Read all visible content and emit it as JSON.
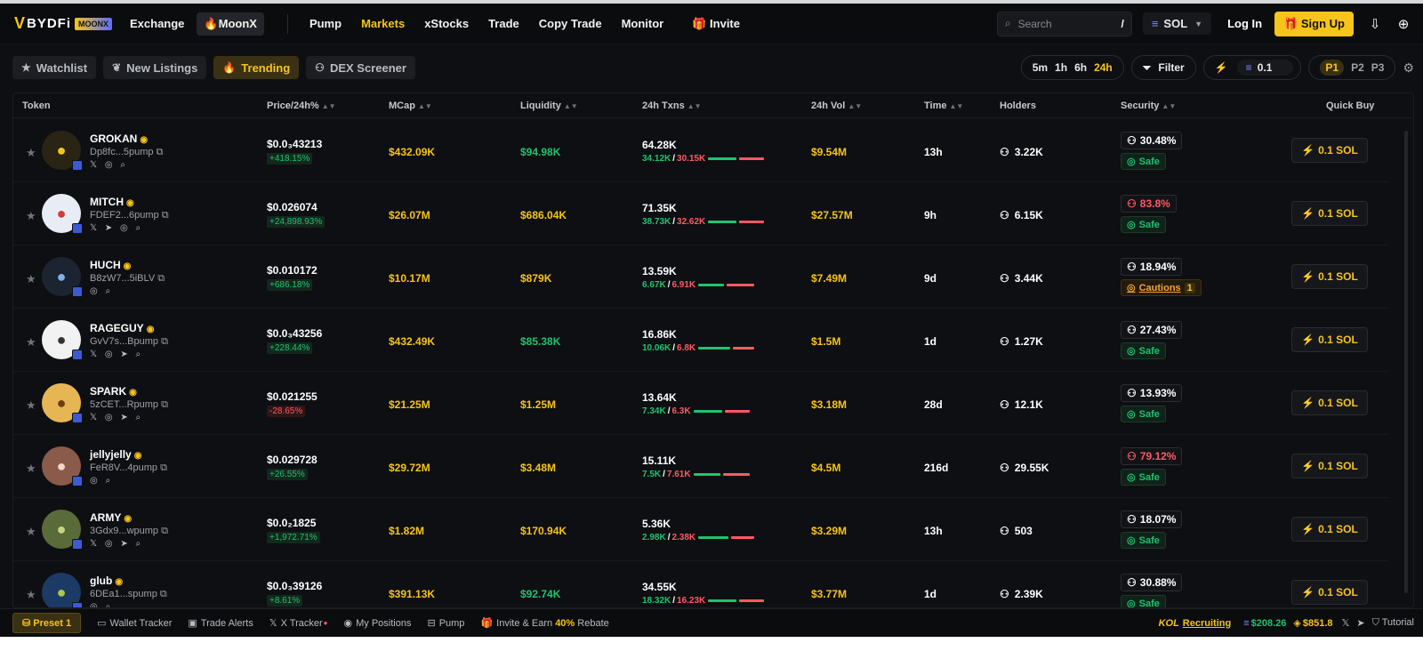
{
  "brand": {
    "name": "BYDFi",
    "badge": "MOONX",
    "mark": "V"
  },
  "nav": {
    "left": [
      {
        "label": "Exchange"
      },
      {
        "label": "MoonX"
      }
    ],
    "main": [
      {
        "label": "Pump"
      },
      {
        "label": "Markets"
      },
      {
        "label": "xStocks"
      },
      {
        "label": "Trade"
      },
      {
        "label": "Copy Trade"
      },
      {
        "label": "Monitor"
      }
    ],
    "invite": "Invite",
    "search_placeholder": "Search",
    "search_shortcut": "/",
    "chain": "SOL",
    "login": "Log In",
    "signup": "Sign Up"
  },
  "subnav": {
    "tabs": [
      {
        "label": "Watchlist"
      },
      {
        "label": "New Listings"
      },
      {
        "label": "Trending"
      },
      {
        "label": "DEX Screener"
      }
    ],
    "timeframes": [
      "5m",
      "1h",
      "6h",
      "24h"
    ],
    "active_timeframe": "24h",
    "filter": "Filter",
    "amount": "0.1",
    "presets": [
      "P1",
      "P2",
      "P3"
    ]
  },
  "table": {
    "headers": {
      "token": "Token",
      "price": "Price/24h%",
      "mcap": "MCap",
      "liquidity": "Liquidity",
      "txns": "24h Txns",
      "vol": "24h Vol",
      "time": "Time",
      "holders": "Holders",
      "security": "Security",
      "quick_buy": "Quick Buy"
    },
    "quick_buy_label": "0.1 SOL",
    "rows": [
      {
        "name": "GROKAN",
        "addr": "Dp8fc...5pump",
        "social": "𝕏 ◎ ⌕",
        "price": "$0.0₃43213",
        "change": "+418.15%",
        "dir": "up",
        "mcap": "$432.09K",
        "liq": "$94.98K",
        "liq_color": "g",
        "txns": "64.28K",
        "buys": "34.12K",
        "sells": "30.15K",
        "buy_ratio": 0.53,
        "vol": "$9.54M",
        "time": "13h",
        "holders": "3.22K",
        "top": "30.48%",
        "top_risk": false,
        "status": "Safe",
        "cautions": "",
        "av_bg": "#2a2415",
        "av_fg": "#f7c41a"
      },
      {
        "name": "MITCH",
        "addr": "FDEF2...6pump",
        "social": "𝕏 ➤ ◎ ⌕",
        "price": "$0.026074",
        "change": "+24,898.93%",
        "dir": "up",
        "mcap": "$26.07M",
        "liq": "$686.04K",
        "liq_color": "y",
        "txns": "71.35K",
        "buys": "38.73K",
        "sells": "32.62K",
        "buy_ratio": 0.54,
        "vol": "$27.57M",
        "time": "9h",
        "holders": "6.15K",
        "top": "83.8%",
        "top_risk": true,
        "status": "Safe",
        "cautions": "",
        "av_bg": "#e8ecf4",
        "av_fg": "#d43a3a"
      },
      {
        "name": "HUCH",
        "addr": "B8zW7...5iBLV",
        "social": "◎ ⌕",
        "price": "$0.010172",
        "change": "+686.18%",
        "dir": "up",
        "mcap": "$10.17M",
        "liq": "$879K",
        "liq_color": "y",
        "txns": "13.59K",
        "buys": "6.67K",
        "sells": "6.91K",
        "buy_ratio": 0.49,
        "vol": "$7.49M",
        "time": "9d",
        "holders": "3.44K",
        "top": "18.94%",
        "top_risk": false,
        "status": "Cautions",
        "cautions": "1",
        "av_bg": "#1b2430",
        "av_fg": "#7fb3e8"
      },
      {
        "name": "RAGEGUY",
        "addr": "GvV7s...Bpump",
        "social": "𝕏 ◎ ➤ ⌕",
        "price": "$0.0₃43256",
        "change": "+228.44%",
        "dir": "up",
        "mcap": "$432.49K",
        "liq": "$85.38K",
        "liq_color": "g",
        "txns": "16.86K",
        "buys": "10.06K",
        "sells": "6.8K",
        "buy_ratio": 0.6,
        "vol": "$1.5M",
        "time": "1d",
        "holders": "1.27K",
        "top": "27.43%",
        "top_risk": false,
        "status": "Safe",
        "cautions": "",
        "av_bg": "#f2f2f2",
        "av_fg": "#333333"
      },
      {
        "name": "SPARK",
        "addr": "5zCET...Rpump",
        "social": "𝕏 ◎ ➤ ⌕",
        "price": "$0.021255",
        "change": "-28.65%",
        "dir": "dn",
        "mcap": "$21.25M",
        "liq": "$1.25M",
        "liq_color": "y",
        "txns": "13.64K",
        "buys": "7.34K",
        "sells": "6.3K",
        "buy_ratio": 0.54,
        "vol": "$3.18M",
        "time": "28d",
        "holders": "12.1K",
        "top": "13.93%",
        "top_risk": false,
        "status": "Safe",
        "cautions": "",
        "av_bg": "#e6b655",
        "av_fg": "#6b3e12"
      },
      {
        "name": "jellyjelly",
        "addr": "FeR8V...4pump",
        "social": "◎ ⌕",
        "price": "$0.029728",
        "change": "+26.55%",
        "dir": "up",
        "mcap": "$29.72M",
        "liq": "$3.48M",
        "liq_color": "y",
        "txns": "15.11K",
        "buys": "7.5K",
        "sells": "7.61K",
        "buy_ratio": 0.5,
        "vol": "$4.5M",
        "time": "216d",
        "holders": "29.55K",
        "top": "79.12%",
        "top_risk": true,
        "status": "Safe",
        "cautions": "",
        "av_bg": "#8a5a4a",
        "av_fg": "#f2d7c6"
      },
      {
        "name": "ARMY",
        "addr": "3Gdx9...wpump",
        "social": "𝕏 ◎ ➤ ⌕",
        "price": "$0.0₂1825",
        "change": "+1,972.71%",
        "dir": "up",
        "mcap": "$1.82M",
        "liq": "$170.94K",
        "liq_color": "y",
        "txns": "5.36K",
        "buys": "2.98K",
        "sells": "2.38K",
        "buy_ratio": 0.56,
        "vol": "$3.29M",
        "time": "13h",
        "holders": "503",
        "top": "18.07%",
        "top_risk": false,
        "status": "Safe",
        "cautions": "",
        "av_bg": "#5a6b3a",
        "av_fg": "#c6d48a"
      },
      {
        "name": "glub",
        "addr": "6DEa1...spump",
        "social": "◎ ⌕",
        "price": "$0.0₃39126",
        "change": "+8.61%",
        "dir": "up",
        "mcap": "$391.13K",
        "liq": "$92.74K",
        "liq_color": "g",
        "txns": "34.55K",
        "buys": "18.32K",
        "sells": "16.23K",
        "buy_ratio": 0.53,
        "vol": "$3.77M",
        "time": "1d",
        "holders": "2.39K",
        "top": "30.88%",
        "top_risk": false,
        "status": "Safe",
        "cautions": "",
        "av_bg": "#1d3a66",
        "av_fg": "#a8c94a"
      }
    ]
  },
  "footer": {
    "preset": "Preset 1",
    "items": [
      "Wallet Tracker",
      "Trade Alerts",
      "X Tracker",
      "My Positions",
      "Pump"
    ],
    "invite_prefix": "Invite & Earn",
    "invite_pct": "40%",
    "invite_suffix": "Rebate",
    "kol": "KOL",
    "recruiting": "Recruiting",
    "bal1": "$208.26",
    "bal2": "$851.8",
    "tutorial": "Tutorial"
  },
  "colors": {
    "accent": "#f7c41a",
    "up": "#1fc36f",
    "down": "#ff5a63"
  }
}
